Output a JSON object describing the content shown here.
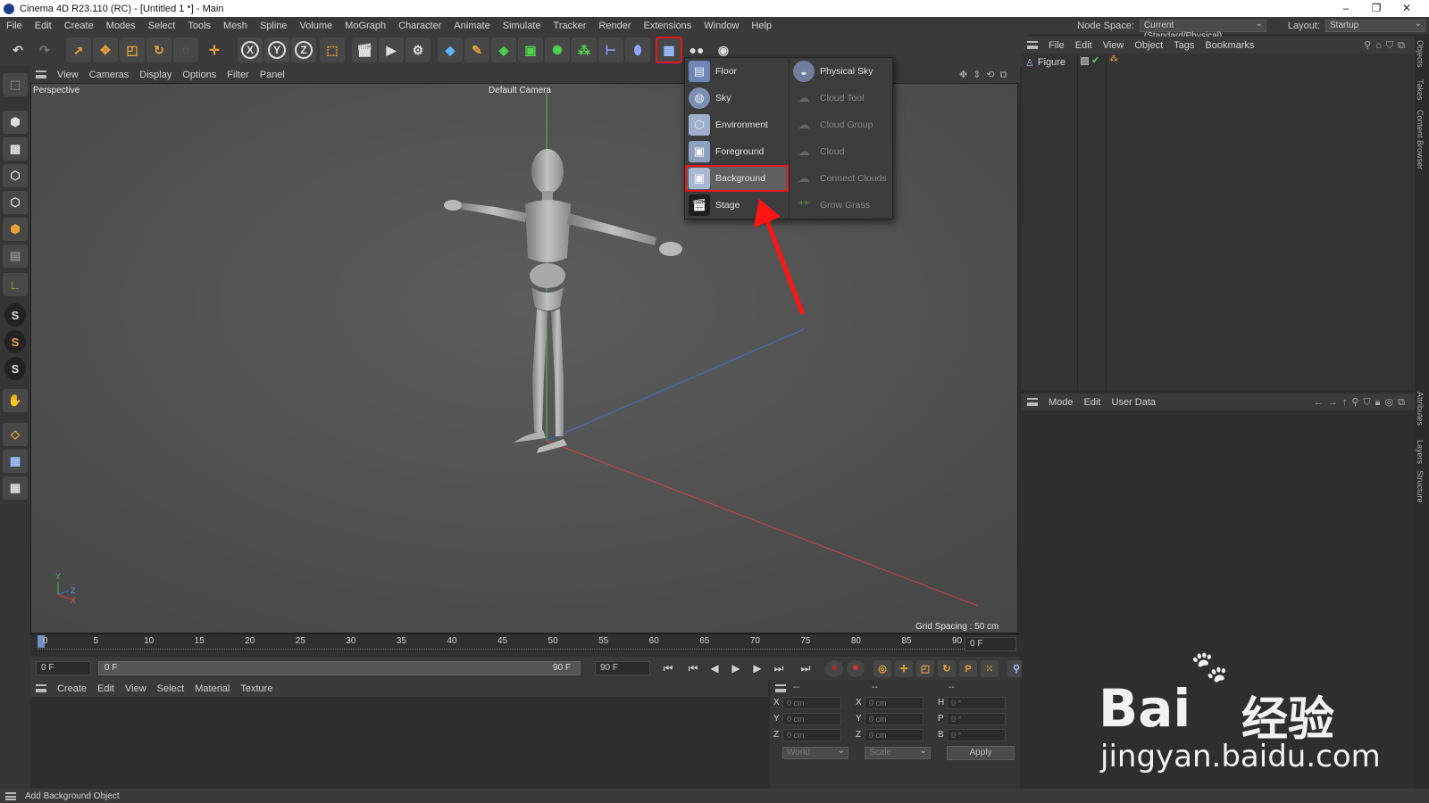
{
  "title_bar": {
    "title": "Cinema 4D R23.110 (RC) - [Untitled 1 *] - Main",
    "min": "–",
    "max": "❐",
    "close": "✕"
  },
  "menu": [
    "File",
    "Edit",
    "Create",
    "Modes",
    "Select",
    "Tools",
    "Mesh",
    "Spline",
    "Volume",
    "MoGraph",
    "Character",
    "Animate",
    "Simulate",
    "Tracker",
    "Render",
    "Extensions",
    "Window",
    "Help"
  ],
  "node_space": {
    "label": "Node Space:",
    "value": "Current (Standard/Physical)"
  },
  "layout": {
    "label": "Layout:",
    "value": "Startup"
  },
  "toolbar": {
    "x_label": "X",
    "y_label": "Y",
    "z_label": "Z"
  },
  "viewport": {
    "menu": [
      "View",
      "Cameras",
      "Display",
      "Options",
      "Filter",
      "Panel"
    ],
    "view_name": "Perspective",
    "camera": "Default Camera",
    "grid_spacing": "Grid Spacing : 50 cm",
    "axis": {
      "y": "Y",
      "z": "Z",
      "x": "X"
    }
  },
  "dropdown": {
    "left": [
      {
        "label": "Floor"
      },
      {
        "label": "Sky"
      },
      {
        "label": "Environment"
      },
      {
        "label": "Foreground"
      },
      {
        "label": "Background"
      },
      {
        "label": "Stage"
      }
    ],
    "right": [
      {
        "label": "Physical Sky"
      },
      {
        "label": "Cloud Tool"
      },
      {
        "label": "Cloud Group"
      },
      {
        "label": "Cloud"
      },
      {
        "label": "Connect Clouds"
      },
      {
        "label": "Grow Grass"
      }
    ]
  },
  "timeline": {
    "ticks": [
      "0",
      "5",
      "10",
      "15",
      "20",
      "25",
      "30",
      "35",
      "40",
      "45",
      "50",
      "55",
      "60",
      "65",
      "70",
      "75",
      "80",
      "85",
      "90"
    ],
    "current_frame": "0 F",
    "start": "0 F",
    "range_start": "0 F",
    "range_end": "90 F",
    "end": "90 F"
  },
  "material_menu": [
    "Create",
    "Edit",
    "View",
    "Select",
    "Material",
    "Texture"
  ],
  "coords": {
    "header1": "--",
    "header2": "--",
    "header3": "--",
    "rows": [
      {
        "a": "X",
        "av": "0 cm",
        "b": "X",
        "bv": "0 cm",
        "c": "H",
        "cv": "0 °"
      },
      {
        "a": "Y",
        "av": "0 cm",
        "b": "Y",
        "bv": "0 cm",
        "c": "P",
        "cv": "0 °"
      },
      {
        "a": "Z",
        "av": "0 cm",
        "b": "Z",
        "bv": "0 cm",
        "c": "B",
        "cv": "0 °"
      }
    ],
    "world": "World",
    "scale": "Scale",
    "apply": "Apply"
  },
  "object_manager": {
    "menu": [
      "File",
      "Edit",
      "View",
      "Object",
      "Tags",
      "Bookmarks"
    ],
    "object_name": "Figure"
  },
  "attributes": {
    "menu": [
      "Mode",
      "Edit",
      "User Data"
    ]
  },
  "side_tabs": [
    "Objects",
    "Takes",
    "Content Browser",
    "Attributes",
    "Layers",
    "Structure"
  ],
  "status": "Add Background Object",
  "watermark": {
    "brand": "Bai",
    "brand2": "经验",
    "url": "jingyan.baidu.com"
  }
}
